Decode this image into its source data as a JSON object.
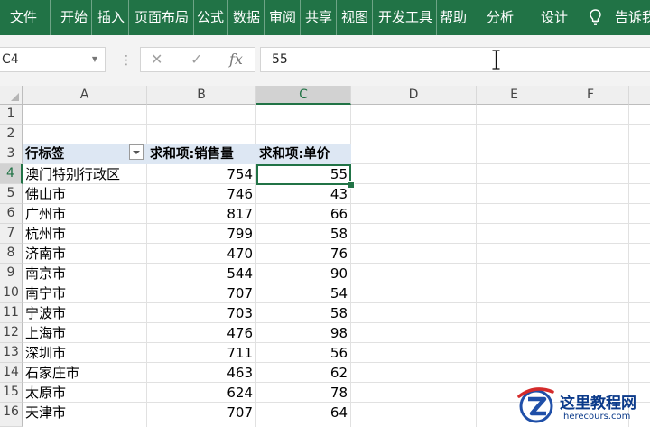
{
  "ribbon": {
    "tabs": [
      "文件",
      "开始",
      "插入",
      "页面布局",
      "公式",
      "数据",
      "审阅",
      "共享",
      "视图",
      "开发工具",
      "帮助",
      "分析",
      "设计",
      "告诉我"
    ]
  },
  "formula_bar": {
    "name_box": "C4",
    "cancel_glyph": "✕",
    "enter_glyph": "✓",
    "fx_label": "fx",
    "value": "55"
  },
  "sheet": {
    "columns": [
      "A",
      "B",
      "C",
      "D",
      "E",
      "F"
    ],
    "rows": [
      "1",
      "2",
      "3",
      "4",
      "5",
      "6",
      "7",
      "8",
      "9",
      "10",
      "11",
      "12",
      "13",
      "14",
      "15",
      "16"
    ],
    "active_cell": "C4",
    "pivot": {
      "headers": [
        "行标签",
        "求和项:销售量",
        "求和项:单价"
      ],
      "records": [
        [
          "澳门特别行政区",
          "754",
          "55"
        ],
        [
          "佛山市",
          "746",
          "43"
        ],
        [
          "广州市",
          "817",
          "66"
        ],
        [
          "杭州市",
          "799",
          "58"
        ],
        [
          "济南市",
          "470",
          "76"
        ],
        [
          "南京市",
          "544",
          "90"
        ],
        [
          "南宁市",
          "707",
          "54"
        ],
        [
          "宁波市",
          "703",
          "58"
        ],
        [
          "上海市",
          "476",
          "98"
        ],
        [
          "深圳市",
          "711",
          "56"
        ],
        [
          "石家庄市",
          "463",
          "62"
        ],
        [
          "太原市",
          "624",
          "78"
        ],
        [
          "天津市",
          "707",
          "64"
        ]
      ]
    }
  },
  "colors": {
    "ribbon": "#217346",
    "pivot_header": "#dde7f3",
    "selection": "#217346"
  },
  "watermark": {
    "title": "这里教程网",
    "url": "herecours.com"
  }
}
